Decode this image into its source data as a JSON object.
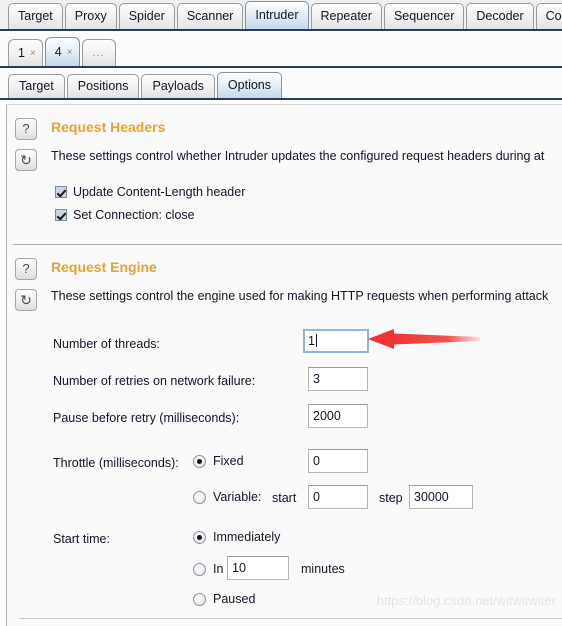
{
  "main_tabs": [
    {
      "label": "Target",
      "selected": false
    },
    {
      "label": "Proxy",
      "selected": false
    },
    {
      "label": "Spider",
      "selected": false
    },
    {
      "label": "Scanner",
      "selected": false
    },
    {
      "label": "Intruder",
      "selected": true
    },
    {
      "label": "Repeater",
      "selected": false
    },
    {
      "label": "Sequencer",
      "selected": false
    },
    {
      "label": "Decoder",
      "selected": false
    },
    {
      "label": "Compare",
      "selected": false
    }
  ],
  "attack_tabs": [
    {
      "label": "1",
      "close": "×",
      "selected": false
    },
    {
      "label": "4",
      "close": "×",
      "selected": true
    },
    {
      "label": "...",
      "selected": false
    }
  ],
  "sub_tabs": [
    {
      "label": "Target",
      "selected": false
    },
    {
      "label": "Positions",
      "selected": false
    },
    {
      "label": "Payloads",
      "selected": false
    },
    {
      "label": "Options",
      "selected": true
    }
  ],
  "request_headers": {
    "help_icon": "?",
    "refresh_icon": "↻",
    "title": "Request Headers",
    "description": "These settings control whether Intruder updates the configured request headers during at",
    "checkboxes": [
      {
        "label": "Update Content-Length header",
        "checked": true
      },
      {
        "label": "Set Connection: close",
        "checked": true
      }
    ]
  },
  "request_engine": {
    "help_icon": "?",
    "refresh_icon": "↻",
    "title": "Request Engine",
    "description": "These settings control the engine used for making HTTP requests when performing attack",
    "threads_label": "Number of threads:",
    "threads_value": "1",
    "retries_label": "Number of retries on network failure:",
    "retries_value": "3",
    "pause_label": "Pause before retry (milliseconds):",
    "pause_value": "2000",
    "throttle_label": "Throttle (milliseconds):",
    "throttle_fixed_label": "Fixed",
    "throttle_fixed_selected": true,
    "throttle_fixed_value": "0",
    "throttle_variable_label": "Variable:",
    "throttle_variable_selected": false,
    "throttle_start_label": "start",
    "throttle_start_value": "0",
    "throttle_step_label": "step",
    "throttle_step_value": "30000",
    "start_time_label": "Start time:",
    "start_immediately_label": "Immediately",
    "start_immediately_selected": true,
    "start_in_label": "In",
    "start_in_selected": false,
    "start_in_value": "10",
    "start_in_unit": "minutes",
    "start_paused_label": "Paused",
    "start_paused_selected": false
  },
  "annotation": {
    "arrow_color": "#f03434",
    "arrow_name": "red-pointer-arrow"
  },
  "watermark": "https://blog.csdn.net/witwitwiter",
  "colors": {
    "accent_heading": "#e8a033",
    "tab_selected": "#c5d8ea",
    "panel_bg": "#fafafa"
  }
}
